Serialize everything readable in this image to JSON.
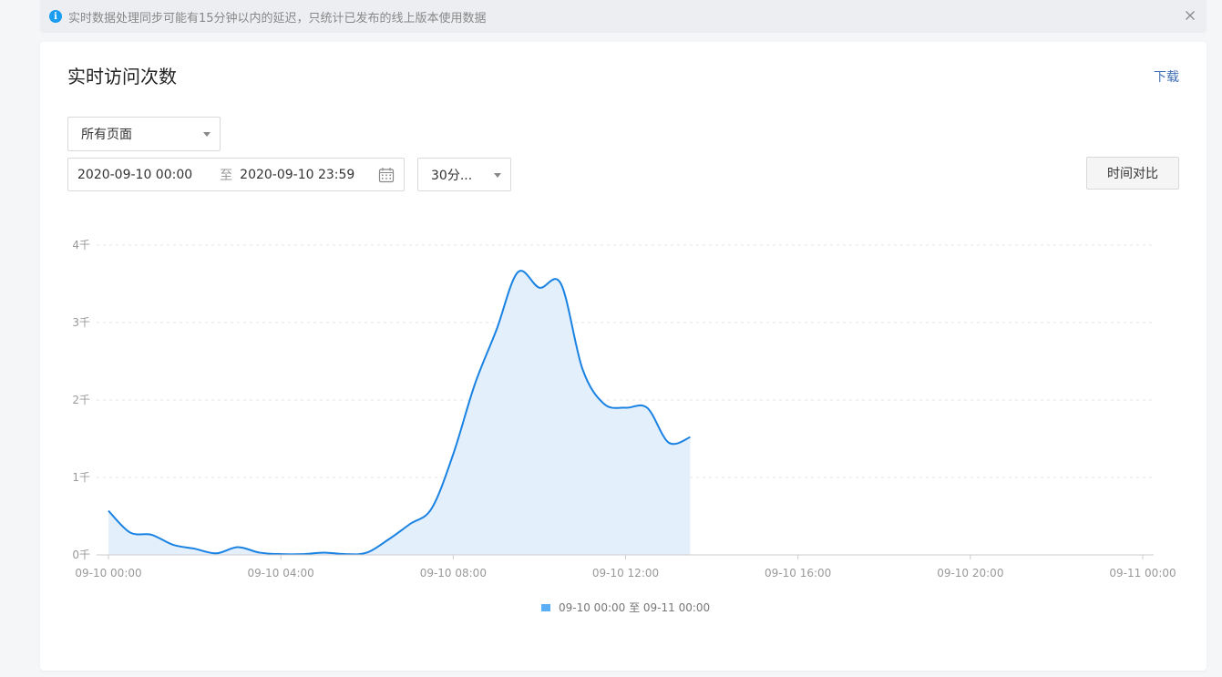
{
  "notice": {
    "text": "实时数据处理同步可能有15分钟以内的延迟，只统计已发布的线上版本使用数据",
    "info_icon_glyph": "i",
    "icon": "info-icon",
    "close_icon": "close-icon"
  },
  "card": {
    "title": "实时访问次数",
    "download_label": "下载"
  },
  "filters": {
    "page_select": "所有页面",
    "date_start": "2020-09-10 00:00",
    "date_separator": "至",
    "date_end": "2020-09-10 23:59",
    "calendar_icon": "calendar-icon",
    "interval_select": "30分...",
    "compare_button": "时间对比"
  },
  "colors": {
    "accent": "#1a82e2",
    "area_fill": "#e3f0fc",
    "link": "#3f6eb5",
    "info": "#1a9cf0"
  },
  "chart_data": {
    "type": "area",
    "y_tick_labels": [
      "0千",
      "1千",
      "2千",
      "3千",
      "4千"
    ],
    "ylim": [
      0,
      4000
    ],
    "x_tick_labels": [
      "09-10 00:00",
      "09-10 04:00",
      "09-10 08:00",
      "09-10 12:00",
      "09-10 16:00",
      "09-10 20:00",
      "09-11 00:00"
    ],
    "xlim_hours": [
      0,
      24
    ],
    "grid": "horizontal dashed",
    "legend_position": "bottom-center",
    "series": [
      {
        "name": "09-10 00:00 至 09-11 00:00",
        "x_hours": [
          0,
          0.5,
          1,
          1.5,
          2,
          2.5,
          3,
          3.5,
          4,
          4.5,
          5,
          5.5,
          6,
          6.5,
          7,
          7.5,
          8,
          8.5,
          9,
          9.5,
          10,
          10.5,
          11,
          11.5,
          12,
          12.5,
          13,
          13.5
        ],
        "values": [
          570,
          290,
          260,
          130,
          80,
          20,
          100,
          30,
          10,
          10,
          30,
          10,
          30,
          200,
          400,
          600,
          1300,
          2200,
          2900,
          3650,
          3450,
          3500,
          2400,
          1950,
          1900,
          1900,
          1450,
          1520
        ]
      }
    ]
  }
}
